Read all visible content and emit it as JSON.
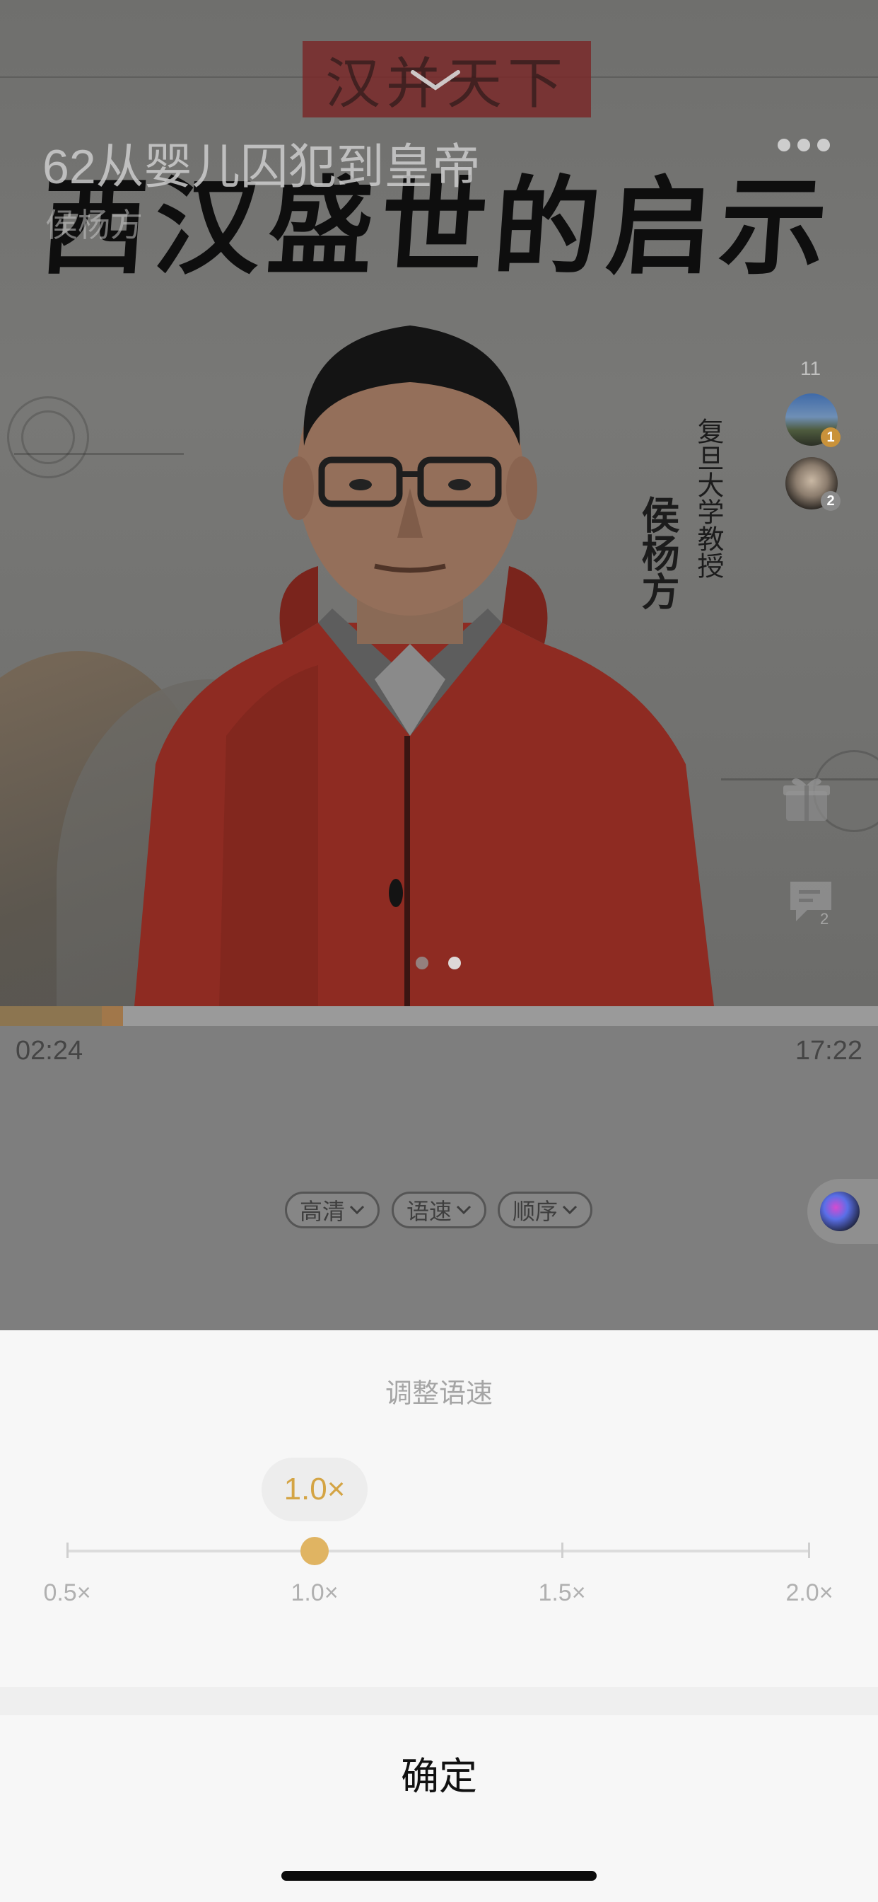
{
  "player": {
    "track_title": "62从婴儿囚犯到皇帝",
    "author": "侯杨方",
    "cover": {
      "seal_text": "汉并天下",
      "calligraphy_title": "西汉盛世的启示",
      "vertical_caption_1": "复旦大学教授",
      "vertical_caption_2": "侯杨方"
    },
    "listeners": {
      "count": "11",
      "avatars": [
        {
          "rank": "1",
          "badge_color": "#c9923a"
        },
        {
          "rank": "2",
          "badge_color": "#8a8a8a"
        }
      ]
    },
    "comment_count": "2",
    "page_dots": {
      "count": 2,
      "active_index": 1
    },
    "progress": {
      "current_time": "02:24",
      "total_time": "17:22",
      "fraction": 0.14
    },
    "options": [
      {
        "label": "高清"
      },
      {
        "label": "语速"
      },
      {
        "label": "顺序"
      }
    ]
  },
  "speed_sheet": {
    "title": "调整语速",
    "current_speed_label": "1.0×",
    "speed_options": [
      "0.5×",
      "1.0×",
      "1.5×",
      "2.0×"
    ],
    "selected_index": 1,
    "confirm_label": "确定"
  },
  "colors": {
    "accent": "#e0b462",
    "accent_text": "#d4a444",
    "progress_fill": "#8c7550"
  }
}
